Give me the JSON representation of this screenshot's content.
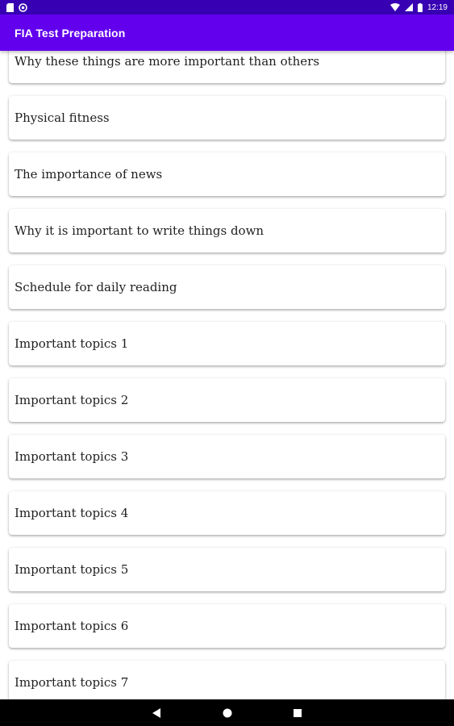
{
  "status_bar": {
    "time": "12:19",
    "left_icons": [
      "sd-card-icon",
      "sync-icon"
    ],
    "right_icons": [
      "wifi-icon",
      "signal-icon",
      "battery-icon"
    ]
  },
  "app_bar": {
    "title": "FIA Test Preparation"
  },
  "list": {
    "items": [
      {
        "label": "Why these things are more important than others"
      },
      {
        "label": "Physical fitness"
      },
      {
        "label": "The importance of news"
      },
      {
        "label": "Why it is important to write things down"
      },
      {
        "label": "Schedule for daily reading"
      },
      {
        "label": "Important topics 1"
      },
      {
        "label": "Important topics 2"
      },
      {
        "label": "Important topics 3"
      },
      {
        "label": "Important topics 4"
      },
      {
        "label": "Important topics 5"
      },
      {
        "label": "Important topics 6"
      },
      {
        "label": "Important topics 7"
      }
    ]
  },
  "nav_bar": {
    "buttons": [
      "back-icon",
      "home-icon",
      "recents-icon"
    ]
  },
  "colors": {
    "status_bar": "#3700b3",
    "app_bar": "#6200ee",
    "nav_bar": "#000000"
  }
}
